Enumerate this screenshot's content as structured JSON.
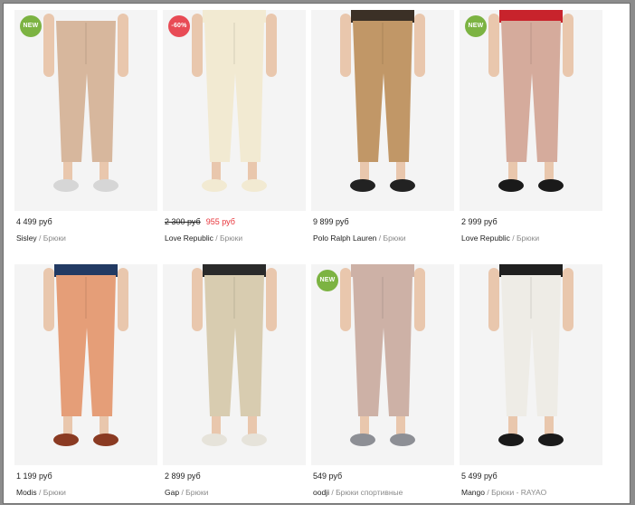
{
  "colors": {
    "new_badge": "#7cb342",
    "sale_badge": "#e84b55",
    "sale_price": "#e8343a"
  },
  "products": [
    {
      "badge": "NEW",
      "badge_type": "new",
      "price": "4 499 руб",
      "old_price": "",
      "brand": "Sisley",
      "category": "Брюки",
      "pants_color": "#d7b79d",
      "top_color": "#f4f4f4",
      "shoes_color": "#d6d6d6"
    },
    {
      "badge": "-60%",
      "badge_type": "sale",
      "price": "",
      "old_price": "2 300 руб",
      "sale_price": "955 руб",
      "brand": "Love Republic",
      "category": "Брюки",
      "pants_color": "#f2ead2",
      "top_color": "#f2ead2",
      "shoes_color": "#f2ead2"
    },
    {
      "badge": "",
      "badge_type": "",
      "price": "9 899 руб",
      "old_price": "",
      "brand": "Polo Ralph Lauren",
      "category": "Брюки",
      "pants_color": "#c19767",
      "top_color": "#3b3026",
      "shoes_color": "#222222"
    },
    {
      "badge": "NEW",
      "badge_type": "new",
      "price": "2 999 руб",
      "old_price": "",
      "brand": "Love Republic",
      "category": "Брюки",
      "pants_color": "#d5ab9c",
      "top_color": "#c8232c",
      "shoes_color": "#1a1a1a"
    },
    {
      "badge": "",
      "badge_type": "",
      "price": "1 199 руб",
      "old_price": "",
      "brand": "Modis",
      "category": "Брюки",
      "pants_color": "#e59e78",
      "top_color": "#223a63",
      "shoes_color": "#8a3a22"
    },
    {
      "badge": "",
      "badge_type": "",
      "price": "2 899 руб",
      "old_price": "",
      "brand": "Gap",
      "category": "Брюки",
      "pants_color": "#d8ccb0",
      "top_color": "#2a2a2a",
      "shoes_color": "#e6e3da"
    },
    {
      "badge": "NEW",
      "badge_type": "new",
      "price": "549 руб",
      "old_price": "",
      "brand": "oodji",
      "category": "Брюки спортивные",
      "pants_color": "#cdb1a6",
      "top_color": "#cdb1a6",
      "shoes_color": "#8d8f95"
    },
    {
      "badge": "",
      "badge_type": "",
      "price": "5 499 руб",
      "old_price": "",
      "brand": "Mango",
      "category": "Брюки - RAYAO",
      "pants_color": "#eeece6",
      "top_color": "#1f1f1f",
      "shoes_color": "#1a1a1a"
    }
  ]
}
